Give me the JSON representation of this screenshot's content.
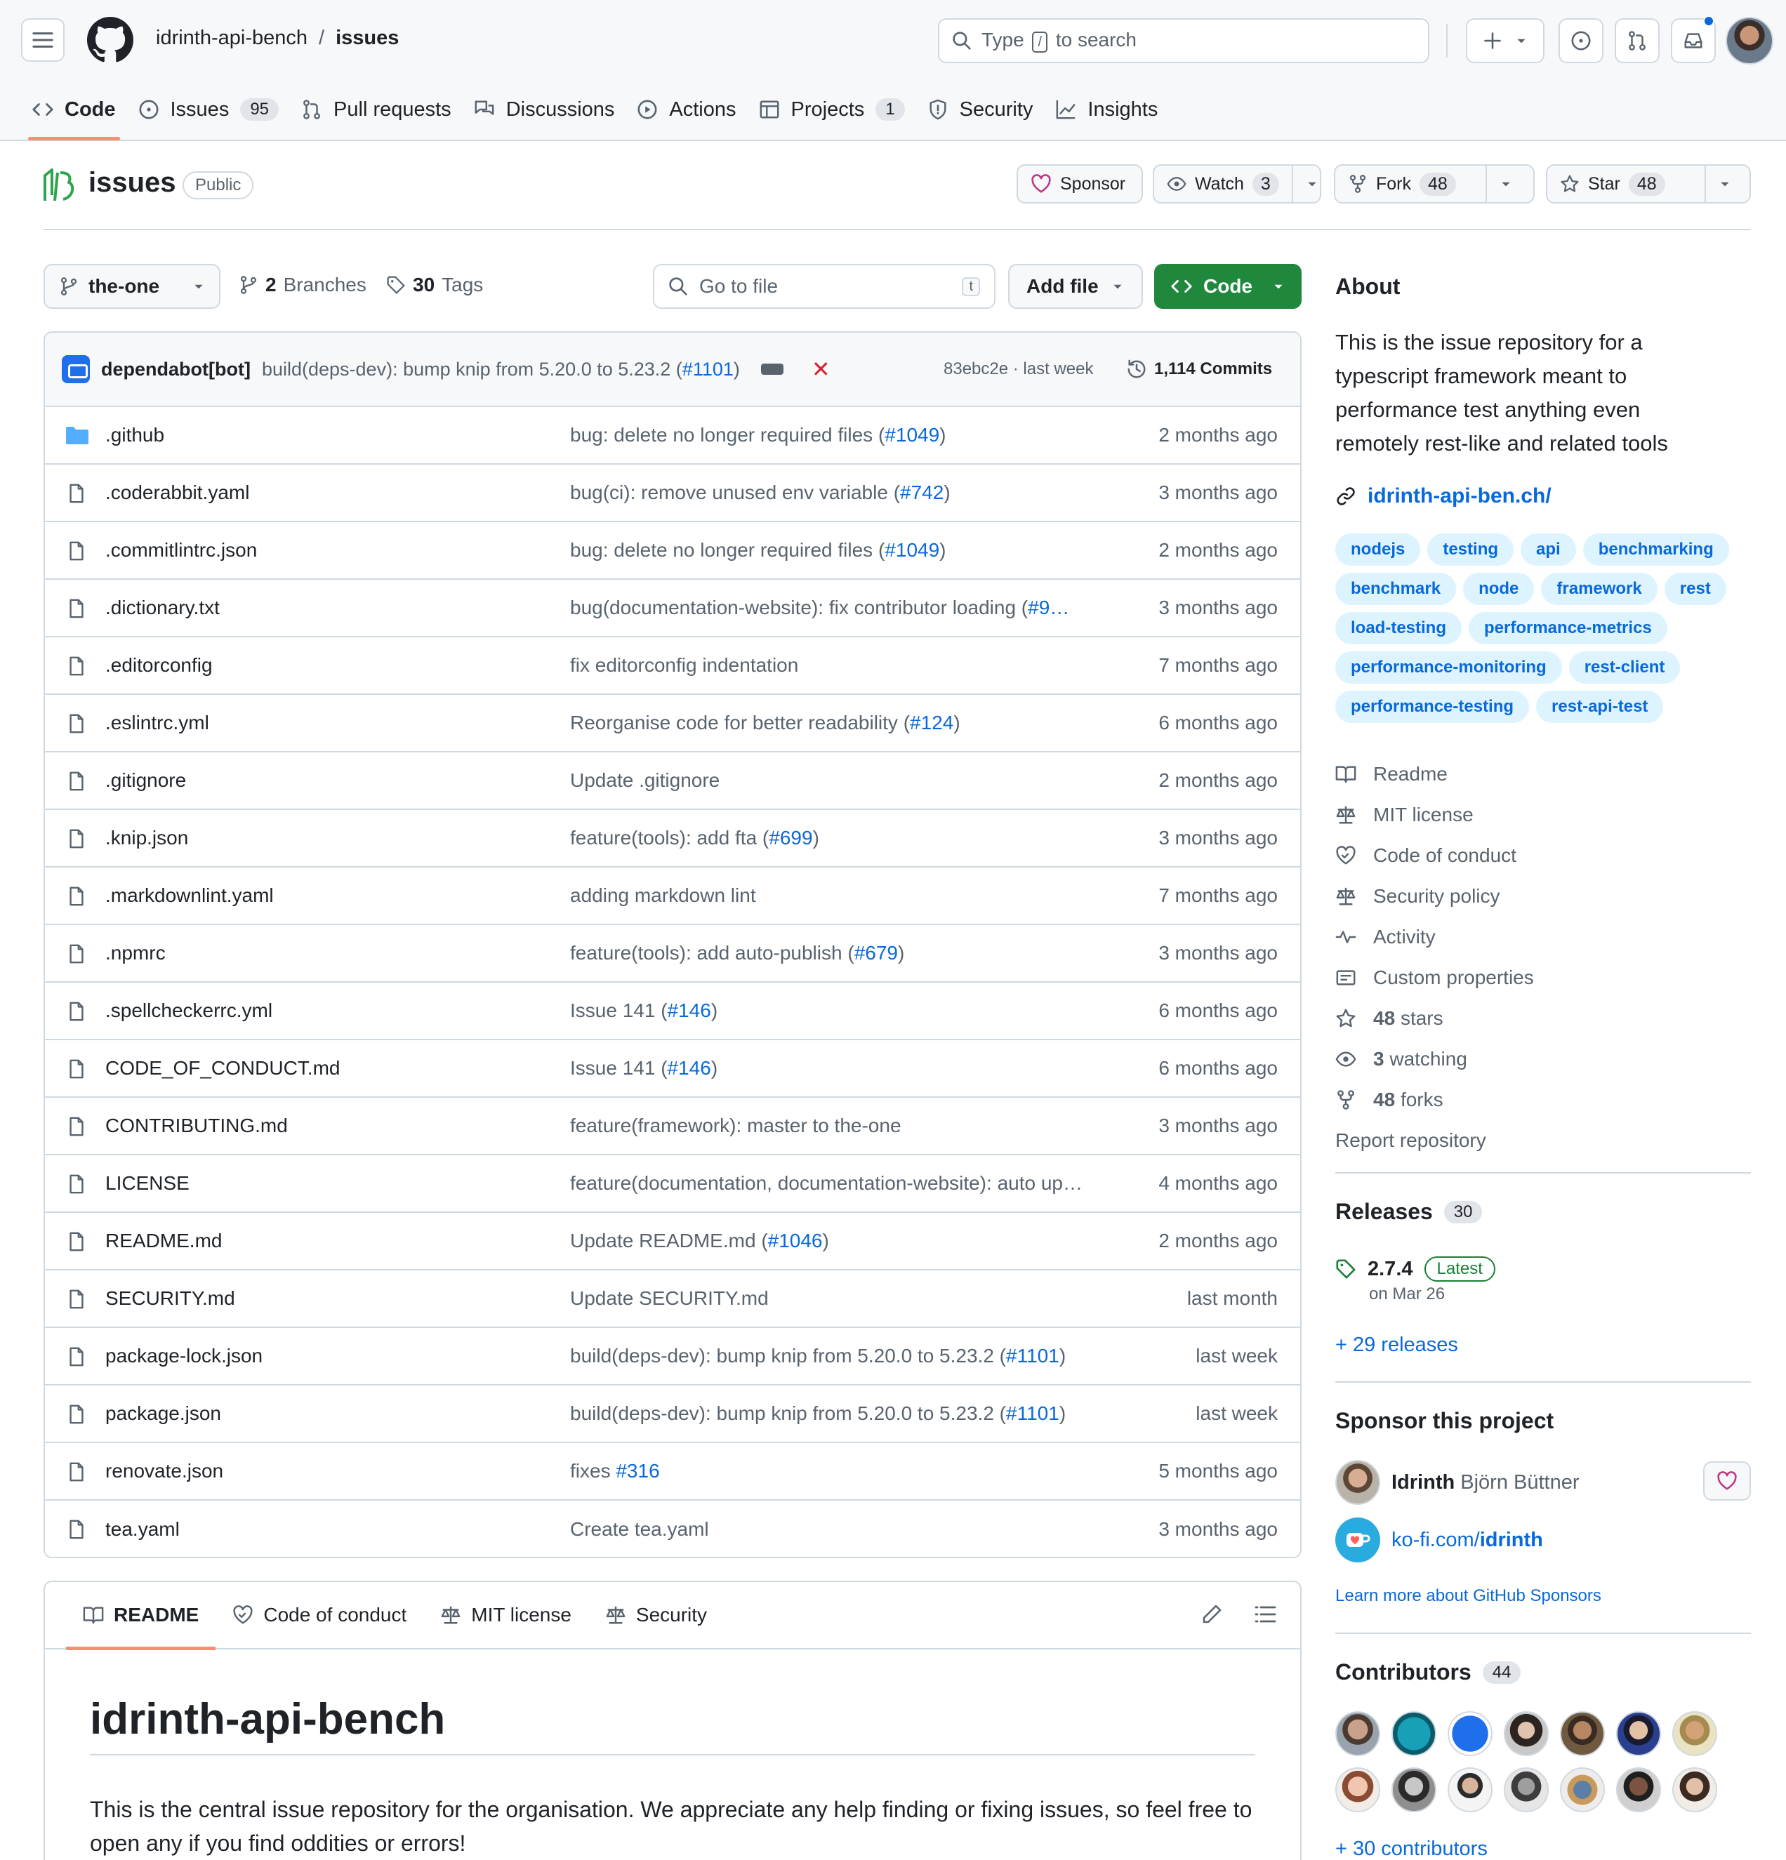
{
  "header": {
    "owner": "idrinth-api-bench",
    "separator": "/",
    "repo": "issues",
    "search_prefix": "Type",
    "search_key": "/",
    "search_suffix": "to search"
  },
  "repo_nav": [
    {
      "label": "Code",
      "count": ""
    },
    {
      "label": "Issues",
      "count": "95"
    },
    {
      "label": "Pull requests",
      "count": ""
    },
    {
      "label": "Discussions",
      "count": ""
    },
    {
      "label": "Actions",
      "count": ""
    },
    {
      "label": "Projects",
      "count": "1"
    },
    {
      "label": "Security",
      "count": ""
    },
    {
      "label": "Insights",
      "count": ""
    }
  ],
  "repo_title": {
    "name": "issues",
    "visibility": "Public",
    "sponsor_label": "Sponsor",
    "watch_label": "Watch",
    "watch_count": "3",
    "fork_label": "Fork",
    "fork_count": "48",
    "star_label": "Star",
    "star_count": "48"
  },
  "file_nav": {
    "branch": "the-one",
    "branches_count": "2",
    "branches_label": "Branches",
    "tags_count": "30",
    "tags_label": "Tags",
    "goto_placeholder": "Go to file",
    "goto_key": "t",
    "add_file_label": "Add file",
    "code_label": "Code"
  },
  "latest_commit": {
    "author": "dependabot[bot]",
    "message": "build(deps-dev): bump knip from 5.20.0 to 5.23.2 (",
    "message_link": "#1101",
    "message_end": ")",
    "status_icon": "x-icon",
    "hash_info": "83ebc2e · last week",
    "commits": "1,114 Commits"
  },
  "files": [
    {
      "name": ".github",
      "type": "dir",
      "msg": "bug: delete no longer required files (",
      "link": "#1049",
      "end": ")",
      "age": "2 months ago"
    },
    {
      "name": ".coderabbit.yaml",
      "type": "file",
      "msg": "bug(ci): remove unused env variable (",
      "link": "#742",
      "end": ")",
      "age": "3 months ago"
    },
    {
      "name": ".commitlintrc.json",
      "type": "file",
      "msg": "bug: delete no longer required files (",
      "link": "#1049",
      "end": ")",
      "age": "2 months ago"
    },
    {
      "name": ".dictionary.txt",
      "type": "file",
      "msg": "bug(documentation-website): fix contributor loading (",
      "link": "#9…",
      "end": "",
      "age": "3 months ago"
    },
    {
      "name": ".editorconfig",
      "type": "file",
      "msg": "fix editorconfig indentation",
      "link": "",
      "end": "",
      "age": "7 months ago"
    },
    {
      "name": ".eslintrc.yml",
      "type": "file",
      "msg": "Reorganise code for better readability (",
      "link": "#124",
      "end": ")",
      "age": "6 months ago"
    },
    {
      "name": ".gitignore",
      "type": "file",
      "msg": "Update .gitignore",
      "link": "",
      "end": "",
      "age": "2 months ago"
    },
    {
      "name": ".knip.json",
      "type": "file",
      "msg": "feature(tools): add fta (",
      "link": "#699",
      "end": ")",
      "age": "3 months ago"
    },
    {
      "name": ".markdownlint.yaml",
      "type": "file",
      "msg": "adding markdown lint",
      "link": "",
      "end": "",
      "age": "7 months ago"
    },
    {
      "name": ".npmrc",
      "type": "file",
      "msg": "feature(tools): add auto-publish (",
      "link": "#679",
      "end": ")",
      "age": "3 months ago"
    },
    {
      "name": ".spellcheckerrc.yml",
      "type": "file",
      "msg": "Issue 141 (",
      "link": "#146",
      "end": ")",
      "age": "6 months ago"
    },
    {
      "name": "CODE_OF_CONDUCT.md",
      "type": "file",
      "msg": "Issue 141 (",
      "link": "#146",
      "end": ")",
      "age": "6 months ago"
    },
    {
      "name": "CONTRIBUTING.md",
      "type": "file",
      "msg": "feature(framework): master to the-one",
      "link": "",
      "end": "",
      "age": "3 months ago"
    },
    {
      "name": "LICENSE",
      "type": "file",
      "msg": "feature(documentation, documentation-website): auto up…",
      "link": "",
      "end": "",
      "age": "4 months ago"
    },
    {
      "name": "README.md",
      "type": "file",
      "msg": "Update README.md (",
      "link": "#1046",
      "end": ")",
      "age": "2 months ago"
    },
    {
      "name": "SECURITY.md",
      "type": "file",
      "msg": "Update SECURITY.md",
      "link": "",
      "end": "",
      "age": "last month"
    },
    {
      "name": "package-lock.json",
      "type": "file",
      "msg": "build(deps-dev): bump knip from 5.20.0 to 5.23.2 (",
      "link": "#1101",
      "end": ")",
      "age": "last week"
    },
    {
      "name": "package.json",
      "type": "file",
      "msg": "build(deps-dev): bump knip from 5.20.0 to 5.23.2 (",
      "link": "#1101",
      "end": ")",
      "age": "last week"
    },
    {
      "name": "renovate.json",
      "type": "file",
      "msg": "fixes ",
      "link": "#316",
      "end": "",
      "age": "5 months ago"
    },
    {
      "name": "tea.yaml",
      "type": "file",
      "msg": "Create tea.yaml",
      "link": "",
      "end": "",
      "age": "3 months ago"
    }
  ],
  "readme": {
    "tabs": [
      "README",
      "Code of conduct",
      "MIT license",
      "Security"
    ],
    "heading": "idrinth-api-bench",
    "paragraph": "This is the central issue repository for the organisation. We appreciate any help finding or fixing issues, so feel free to open any if you find oddities or errors!"
  },
  "sidebar": {
    "about_title": "About",
    "description": "This is the issue repository for a typescript framework meant to performance test anything even remotely rest-like and related tools",
    "website": "idrinth-api-ben.ch/",
    "topics": [
      "nodejs",
      "testing",
      "api",
      "benchmarking",
      "benchmark",
      "node",
      "framework",
      "rest",
      "load-testing",
      "performance-metrics",
      "performance-monitoring",
      "rest-client",
      "performance-testing",
      "rest-api-test"
    ],
    "meta": [
      {
        "icon": "book-icon",
        "label": "Readme",
        "bold": ""
      },
      {
        "icon": "law-icon",
        "label": "MIT license",
        "bold": ""
      },
      {
        "icon": "heart-handshake-icon",
        "label": "Code of conduct",
        "bold": ""
      },
      {
        "icon": "law-icon",
        "label": "Security policy",
        "bold": ""
      },
      {
        "icon": "pulse-icon",
        "label": "Activity",
        "bold": ""
      },
      {
        "icon": "note-icon",
        "label": "Custom properties",
        "bold": ""
      },
      {
        "icon": "star-icon",
        "label": "stars",
        "bold": "48"
      },
      {
        "icon": "eye-icon",
        "label": "watching",
        "bold": "3"
      },
      {
        "icon": "fork-icon",
        "label": "forks",
        "bold": "48"
      }
    ],
    "report": "Report repository",
    "releases_title": "Releases",
    "releases_count": "30",
    "release_version": "2.7.4",
    "release_badge": "Latest",
    "release_date": "on Mar 26",
    "more_releases": "+ 29 releases",
    "sponsor_title": "Sponsor this project",
    "sponsor_login": "Idrinth",
    "sponsor_name": "Björn Büttner",
    "kofi_prefix": "ko-fi.com/",
    "kofi_user": "idrinth",
    "learn_sponsors": "Learn more about GitHub Sponsors",
    "contributors_title": "Contributors",
    "contributors_count": "44",
    "more_contributors": "+ 30 contributors"
  },
  "colors": {
    "accent_blue": "#0969da",
    "code_green": "#1f883d",
    "underline_orange": "#fd8c73",
    "fail_red": "#d1242f",
    "border": "#d1d9e0"
  }
}
